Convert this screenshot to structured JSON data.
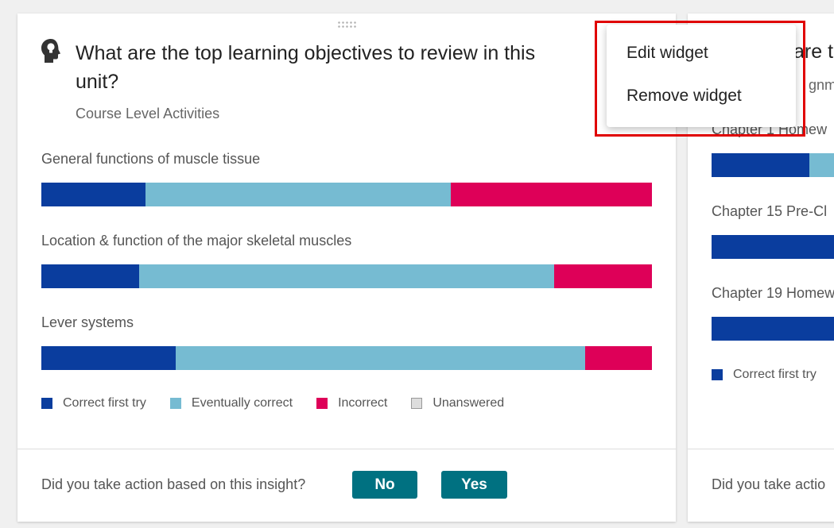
{
  "widget": {
    "title": "What are the top learning objectives to review in this unit?",
    "subtitle": "Course Level Activities",
    "objectives": [
      {
        "label": "General functions of muscle tissue",
        "correct_first_try": 17,
        "eventually_correct": 50,
        "incorrect": 33,
        "unanswered": 0
      },
      {
        "label": "Location & function of the major skeletal muscles",
        "correct_first_try": 16,
        "eventually_correct": 68,
        "incorrect": 16,
        "unanswered": 0
      },
      {
        "label": "Lever systems",
        "correct_first_try": 22,
        "eventually_correct": 67,
        "incorrect": 11,
        "unanswered": 0
      }
    ],
    "legend": {
      "correct_first_try": "Correct first try",
      "eventually_correct": "Eventually correct",
      "incorrect": "Incorrect",
      "unanswered": "Unanswered"
    },
    "prompt": "Did you take action based on this insight?",
    "no_label": "No",
    "yes_label": "Yes"
  },
  "widget2": {
    "title_fragment": "are t",
    "subtitle_fragment": "gnmen",
    "rows": [
      {
        "label": "Chapter 1 Homew"
      },
      {
        "label": "Chapter 15 Pre-Cl"
      },
      {
        "label": "Chapter 19 Homew"
      }
    ],
    "legend_label": "Correct first try",
    "prompt": "Did you take actio"
  },
  "menu": {
    "edit_label": "Edit widget",
    "remove_label": "Remove widget"
  },
  "colors": {
    "correct_first_try": "#0a3d9e",
    "eventually_correct": "#76bbd2",
    "incorrect": "#de0058",
    "unanswered": "#dddddd",
    "button": "#007181",
    "highlight": "#e00000"
  },
  "icons": {
    "widget_icon": "head-lightbulb-icon",
    "drag_icon": "drag-handle-icon"
  }
}
